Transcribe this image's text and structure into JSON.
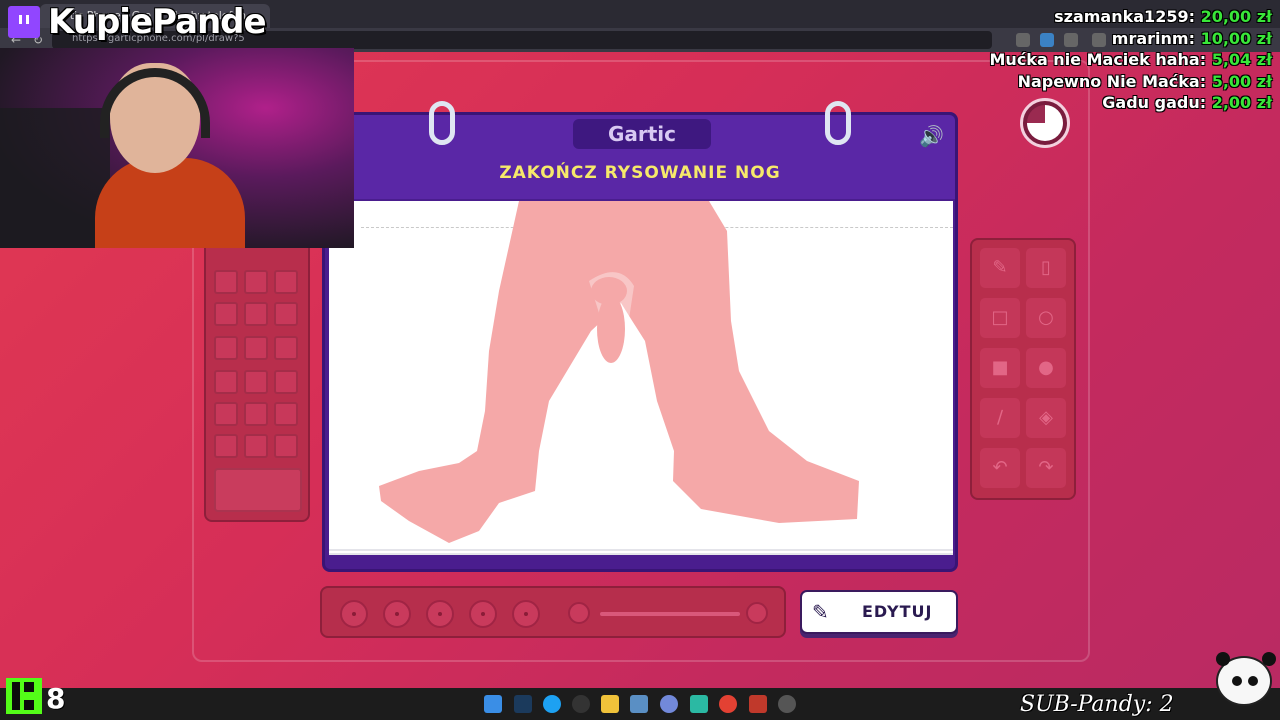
{
  "browser": {
    "tab_title": "Gartic Phone - Gra w głuchy telefon",
    "url": "https://garticphone.com/pl/draw?5"
  },
  "stream": {
    "channel_name": "KupiePande",
    "donations": [
      {
        "name": "szamanka1259:",
        "amount": "20,00 zł"
      },
      {
        "name": "mrarinm:",
        "amount": "10,00 zł"
      },
      {
        "name": "Mućka nie Maciek haha:",
        "amount": "5,04 zł"
      },
      {
        "name": "Napewno Nie Maćka:",
        "amount": "5,00 zł"
      },
      {
        "name": "Gadu gadu:",
        "amount": "2,00 zł"
      }
    ],
    "kick_viewers": "8",
    "sub_counter": "SUB-Pandy: 2"
  },
  "game": {
    "logo": "Gartic",
    "prompt": "ZAKOŃCZ RYSOWANIE NOG",
    "sound_icon": "speaker-icon",
    "edit_button": "EDYTUJ",
    "timer_remaining": 0.75,
    "colors": {
      "background": "#d62e57",
      "notebook": "#4a1d8e",
      "prompt_text": "#f6e96a",
      "drawing": "#f5a8a8"
    },
    "tools": [
      "pencil-icon",
      "eraser-icon",
      "square-outline-icon",
      "circle-outline-icon",
      "square-filled-icon",
      "circle-filled-icon",
      "line-icon",
      "fill-bucket-icon",
      "undo-icon",
      "redo-icon"
    ],
    "brush_sizes": 5
  }
}
